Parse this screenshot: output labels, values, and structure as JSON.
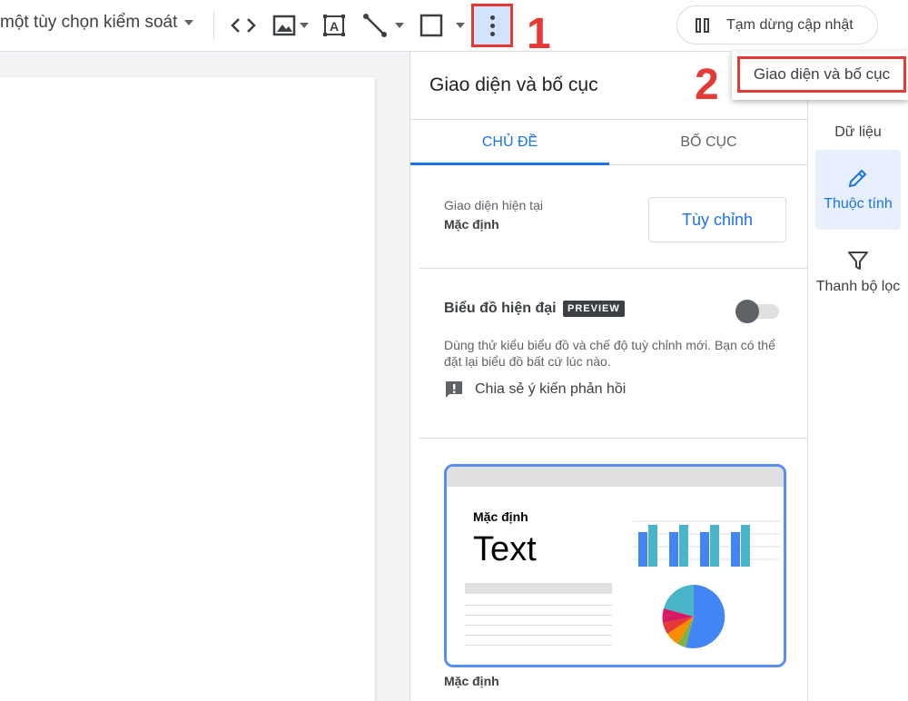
{
  "toolbar": {
    "control_label": "một tùy chọn kiểm soát",
    "pause_label": "Tạm dừng cập nhật"
  },
  "annotations": {
    "step1": "1",
    "step2": "2",
    "color": "#e53935"
  },
  "menu": {
    "item_label": "Giao diện và bố cục"
  },
  "panel": {
    "title": "Giao diện và bố cục",
    "tabs": [
      {
        "label": "CHỦ ĐỀ",
        "active": true
      },
      {
        "label": "BỐ CỤC",
        "active": false
      }
    ],
    "current_theme": {
      "label": "Giao diện hiện tại",
      "value": "Mặc định",
      "customize_label": "Tùy chỉnh"
    },
    "modern_charts": {
      "title": "Biểu đồ hiện đại",
      "badge": "PREVIEW",
      "enabled": false,
      "description": "Dùng thử kiểu biểu đồ và chế độ tuỳ chỉnh mới. Bạn có thể đặt lại biểu đồ bất cứ lúc nào.",
      "feedback_label": "Chia sẻ ý kiến phản hồi"
    },
    "theme_card": {
      "name": "Mặc định",
      "sample_text": "Text",
      "caption": "Mặc định"
    }
  },
  "rail": {
    "items": [
      {
        "label": "Dữ liệu",
        "icon": "data-icon"
      },
      {
        "label": "Thuộc tính",
        "icon": "pencil-icon",
        "active": true
      },
      {
        "label": "Thanh bộ lọc",
        "icon": "filter-icon"
      }
    ]
  },
  "colors": {
    "accent": "#1a73e8",
    "annotation": "#e53935"
  }
}
